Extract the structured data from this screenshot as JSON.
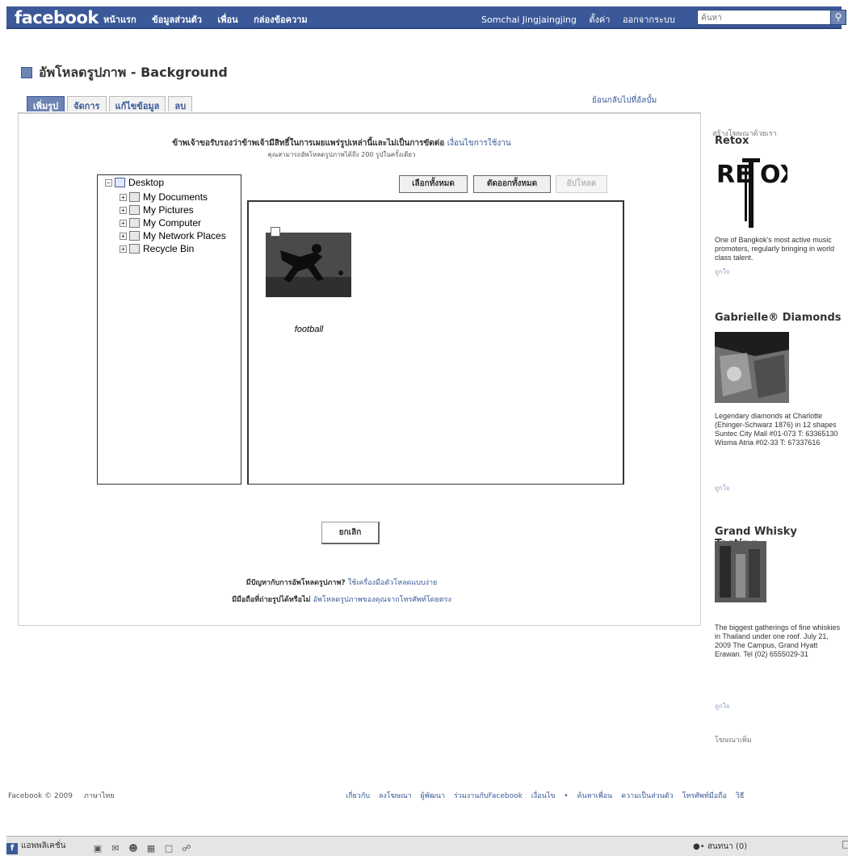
{
  "topbar": {
    "logo": "facebook",
    "nav_left": [
      "หน้าแรก",
      "ข้อมูลส่วนตัว",
      "เพื่อน",
      "กล่องข้อความ"
    ],
    "nav_right": [
      "Somchai Jingjaingjing",
      "ตั้งค่า",
      "ออกจากระบบ"
    ],
    "search_placeholder": "ค้นหา",
    "search_icon": "magnifier-icon"
  },
  "page": {
    "title": "อัพโหลดรูปภาพ - Background",
    "tabs": [
      "เพิ่มรูป",
      "จัดการ",
      "แก้ไขข้อมูล",
      "ลบ"
    ],
    "back_link": "ย้อนกลับไปที่อัลบั้ม"
  },
  "uploader": {
    "notice_line1": "ข้าพเจ้าขอรับรองว่าข้าพเจ้ามีสิทธิ์ในการเผยแพร่รูปเหล่านี้และไม่เป็นการขัดต่อ",
    "notice_link": "เงื่อนไขการใช้งาน",
    "notice_line2": "คุณสามารถอัพโหลดรูปภาพได้ถึง 200 รูปในครั้งเดียว",
    "tree": [
      {
        "label": "Desktop",
        "icon": "desktop-icon",
        "expander": "−"
      },
      {
        "label": "My Documents",
        "icon": "folder-icon",
        "expander": "+"
      },
      {
        "label": "My Pictures",
        "icon": "folder-icon",
        "expander": "+"
      },
      {
        "label": "My Computer",
        "icon": "computer-icon",
        "expander": "+"
      },
      {
        "label": "My Network Places",
        "icon": "network-icon",
        "expander": "+"
      },
      {
        "label": "Recycle Bin",
        "icon": "recycle-bin-icon",
        "expander": "+"
      }
    ],
    "select_all": "เลือกทั้งหมด",
    "deselect_all": "ตัดออกทั้งหมด",
    "upload": "อัปโหลด",
    "photo_name": "football",
    "cancel": "ยกเลิก",
    "help_line1_prefix": "มีปัญหากับการอัพโหลดรูปภาพ?",
    "help_line1_link": "ใช้เครื่องมือตัวโหลดแบบง่าย",
    "help_line2_prefix": "มีมือถือที่ถ่ายรูปได้หรือไม่",
    "help_line2_link": "อัพโหลดรูปภาพของคุณจากโทรศัพท์โดยตรง"
  },
  "sidebar": {
    "top_label": "สร้างโฆษณาด้วยเรา",
    "ads": [
      {
        "title": "Retox",
        "text": "One of Bangkok's most active music promoters, regularly bringing in world class talent.",
        "like": "ถูกใจ"
      },
      {
        "title": "Gabrielle® Diamonds",
        "text": "Legendary diamonds at Charlotte (Ehinger-Schwarz 1876) in 12 shapes Suntec City Mall #01-073 T: 63365130 Wisma Atria #02-33 T: 67337616",
        "like": "ถูกใจ"
      },
      {
        "title": "Grand Whisky Tasting",
        "text": "The biggest gatherings of fine whiskies in Thailand under one roof. July 21, 2009 The Campus, Grand Hyatt Erawan. Tel (02) 6555029-31",
        "like": "ถูกใจ"
      }
    ],
    "logo_text": "RE  OX",
    "bottom_label": "โฆษณาเพิ่ม"
  },
  "footer": {
    "copyright": "Facebook © 2009",
    "language": "ภาษาไทย",
    "links": [
      "เกี่ยวกับ",
      "ลงโฆษณา",
      "ผู้พัฒนา",
      "ร่วมงานกับFacebook",
      "เงื่อนไข",
      "•",
      "ค้นหาเพื่อน",
      "ความเป็นส่วนตัว",
      "โทรศัพท์มือถือ",
      "วิธี"
    ]
  },
  "chatbar": {
    "applications": "แอพพลิเคชั่น",
    "online": "สนทนา (0)"
  }
}
